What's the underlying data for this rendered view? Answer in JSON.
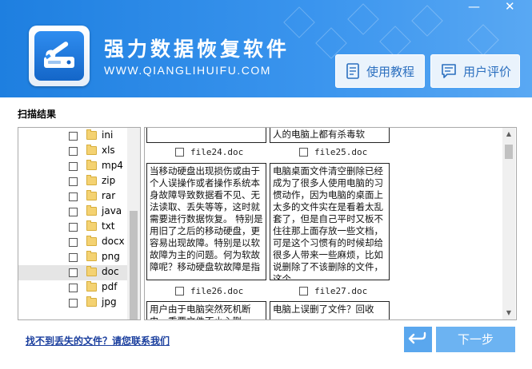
{
  "header": {
    "app_title": "强力数据恢复软件",
    "app_url": "WWW.QIANGLIHUIFU.COM",
    "minimize_glyph": "—",
    "close_glyph": "✕",
    "tutorial_label": "使用教程",
    "review_label": "用户评价",
    "background_color": "#2a8bea"
  },
  "scan": {
    "section_label": "扫描结果"
  },
  "tree": {
    "items": [
      {
        "label": "ini",
        "checked": false
      },
      {
        "label": "xls",
        "checked": false
      },
      {
        "label": "mp4",
        "checked": false
      },
      {
        "label": "zip",
        "checked": false
      },
      {
        "label": "rar",
        "checked": false
      },
      {
        "label": "java",
        "checked": false
      },
      {
        "label": "txt",
        "checked": false
      },
      {
        "label": "docx",
        "checked": false
      },
      {
        "label": "png",
        "checked": false
      },
      {
        "label": "doc",
        "checked": false,
        "selected": true
      },
      {
        "label": "pdf",
        "checked": false
      },
      {
        "label": "jpg",
        "checked": false
      }
    ]
  },
  "files": {
    "top_card_text": "人的电脑上都有杀毒软",
    "items": [
      {
        "name": "file24.doc",
        "preview": ""
      },
      {
        "name": "file25.doc",
        "preview": ""
      },
      {
        "name": "file26.doc",
        "preview": "当移动硬盘出现损伤或由于个人误操作或者操作系统本身故障导致数据看不见、无法读取、丢失等等，这时就需要进行数据恢复。 特别是用旧了之后的移动硬盘，更容易出现故障。特别是以软故障为主的问题。何为软故障呢？移动硬盘软故障是指"
      },
      {
        "name": "file27.doc",
        "preview": "电脑桌面文件清空删除已经成为了很多人使用电脑的习惯动作，因为电脑的桌面上太多的文件实在是看着太乱套了，但是自己平时又板不住往那上面存放一些文档，可是这个习惯有的时候却给很多人带来一些麻烦，比如说删除了不该删除的文件，这个"
      },
      {
        "name": "",
        "preview": "用户由于电脑突然死机断电，重要文件不小心删"
      },
      {
        "name": "",
        "preview": "电脑上误删了文件？回收"
      }
    ]
  },
  "footer": {
    "help_link": "找不到丢失的文件？请您联系我们",
    "back_icon": "↩",
    "next_label": "下一步"
  }
}
